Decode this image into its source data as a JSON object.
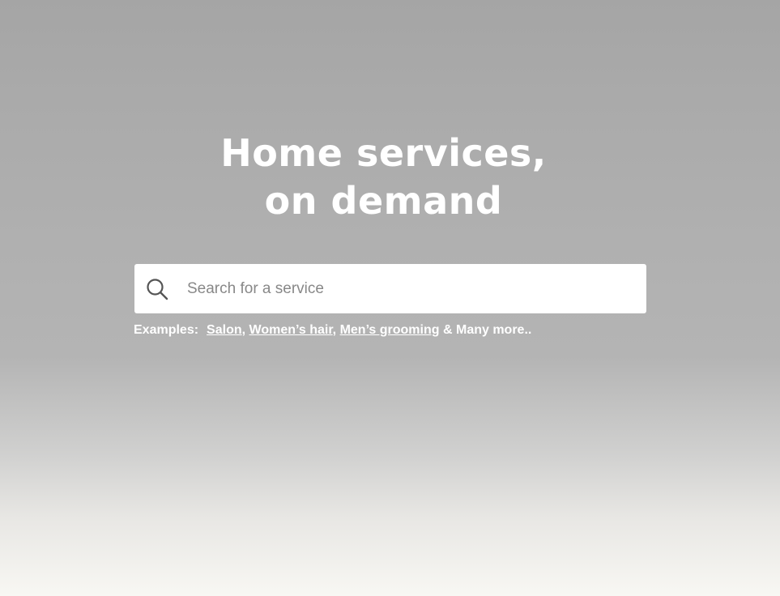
{
  "hero": {
    "headline_line1": "Home services,",
    "headline_line2": "on demand"
  },
  "search": {
    "icon": "search-icon",
    "placeholder": "Search for a service",
    "value": ""
  },
  "examples": {
    "label": "Examples:",
    "links": [
      "Salon",
      "Women’s hair",
      "Men’s grooming"
    ],
    "separator": ",",
    "trailing": "& Many more.."
  },
  "colors": {
    "headline": "#ffffff",
    "search_box": "#ffffff",
    "placeholder": "#888888",
    "icon": "#555555"
  }
}
